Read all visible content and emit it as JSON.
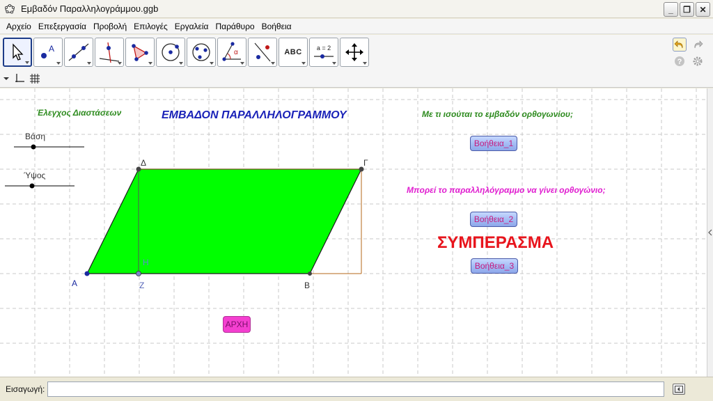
{
  "window": {
    "title": "Εμβαδόν Παραλληλογράμμου.ggb",
    "app_icon": "geogebra-icon",
    "controls": [
      "minimize",
      "maximize",
      "close"
    ]
  },
  "menu": {
    "items": [
      "Αρχείο",
      "Επεξεργασία",
      "Προβολή",
      "Επιλογές",
      "Εργαλεία",
      "Παράθυρο",
      "Βοήθεια"
    ]
  },
  "toolbar": {
    "tools": [
      {
        "name": "move-tool",
        "icon": "arrow-pointer-icon",
        "selected": true
      },
      {
        "name": "point-tool",
        "icon": "point-icon"
      },
      {
        "name": "line-tool",
        "icon": "line-through-points-icon"
      },
      {
        "name": "perpendicular-tool",
        "icon": "perpendicular-line-icon"
      },
      {
        "name": "polygon-tool",
        "icon": "polygon-icon"
      },
      {
        "name": "circle-tool",
        "icon": "circle-center-point-icon"
      },
      {
        "name": "ellipse-tool",
        "icon": "ellipse-icon"
      },
      {
        "name": "angle-tool",
        "icon": "angle-icon"
      },
      {
        "name": "reflect-tool",
        "icon": "reflect-icon"
      },
      {
        "name": "text-tool",
        "icon": "text-icon",
        "label": "ABC"
      },
      {
        "name": "slider-tool",
        "icon": "slider-icon",
        "label": "a = 2"
      },
      {
        "name": "move-graphics-tool",
        "icon": "move-view-icon"
      }
    ],
    "right": [
      "undo-icon",
      "redo-icon",
      "help-icon",
      "gear-icon"
    ]
  },
  "stylebar": {
    "icons": [
      "dropdown-triangle-icon",
      "axes-icon",
      "grid-icon"
    ]
  },
  "graphics": {
    "check_dimensions": "Έλεγχος Διαστάσεων",
    "main_title": "ΕΜΒΑΔΟΝ ΠΑΡΑΛΛΗΛΟΓΡΑΜΜΟΥ",
    "question_1": "Με τι ισούται το εμβαδόν ορθογωνίου;",
    "question_2": "Μπορεί το παραλληλόγραμμο να γίνει ορθογώνιο;",
    "conclusion": "ΣΥΜΠΕΡΑΣΜΑ",
    "sliders": [
      {
        "label": "Βάση"
      },
      {
        "label": "Ύψος"
      }
    ],
    "points": {
      "A": "Α",
      "B": "Β",
      "G": "Γ",
      "D": "Δ",
      "Z": "Ζ",
      "H": "Η"
    },
    "buttons": {
      "help_1": "Βοήθεια_1",
      "help_2": "Βοήθεια_2",
      "help_3": "Βοήθεια_3",
      "start": "ΑΡΧΗ"
    },
    "colors": {
      "parallelogram_fill": "#00ff00",
      "title_blue": "#1a22b8",
      "question_green": "#2e8b1f",
      "question_magenta": "#e01fd0",
      "conclusion_red": "#e8141c",
      "help_button_text": "#c8197d",
      "start_button": "#f43fd0"
    }
  },
  "input_bar": {
    "label": "Εισαγωγή:",
    "value": ""
  }
}
